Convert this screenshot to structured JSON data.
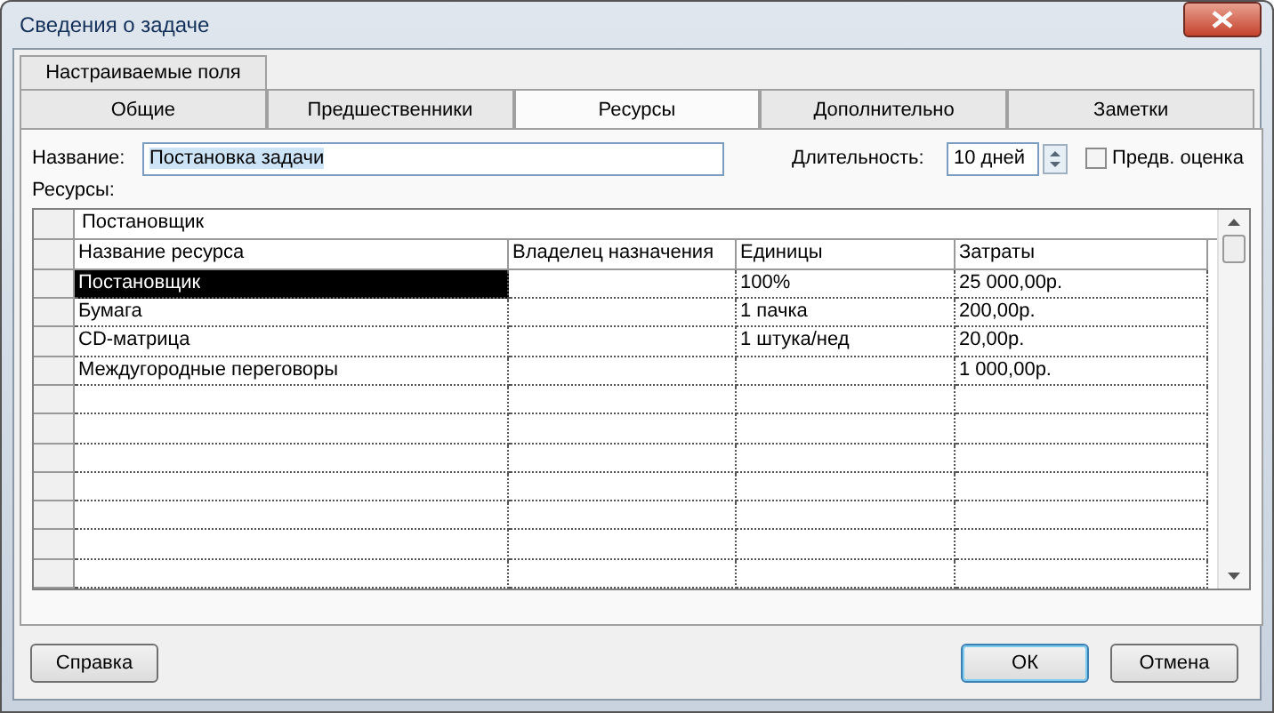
{
  "window": {
    "title": "Сведения о задаче"
  },
  "tab_rows": [
    [
      {
        "label": "Настраиваемые поля",
        "selected": false
      }
    ],
    [
      {
        "label": "Общие",
        "selected": false
      },
      {
        "label": "Предшественники",
        "selected": false
      },
      {
        "label": "Ресурсы",
        "selected": true
      },
      {
        "label": "Дополнительно",
        "selected": false
      },
      {
        "label": "Заметки",
        "selected": false
      }
    ]
  ],
  "name_field": {
    "label": "Название:",
    "value": "Постановка задачи"
  },
  "duration_field": {
    "label": "Длительность:",
    "value": "10 дней"
  },
  "estimate_checkbox": {
    "label": "Предв. оценка",
    "checked": false
  },
  "resources_label": "Ресурсы:",
  "grid": {
    "edit_bar": "Постановщик",
    "columns": [
      "Название ресурса",
      "Владелец назначения",
      "Единицы",
      "Затраты"
    ],
    "rows": [
      {
        "cells": [
          "Постановщик",
          "",
          "100%",
          "25 000,00р."
        ],
        "selected": true
      },
      {
        "cells": [
          "Бумага",
          "",
          "1 пачка",
          "200,00р."
        ],
        "selected": false
      },
      {
        "cells": [
          "CD-матрица",
          "",
          "1 штука/нед",
          "20,00р."
        ],
        "selected": false
      },
      {
        "cells": [
          "Междугородные переговоры",
          "",
          "",
          "1 000,00р."
        ],
        "selected": false
      }
    ]
  },
  "buttons": [
    {
      "label": "Справка",
      "default": false
    },
    {
      "label": "ОК",
      "default": true
    },
    {
      "label": "Отмена",
      "default": false
    }
  ]
}
